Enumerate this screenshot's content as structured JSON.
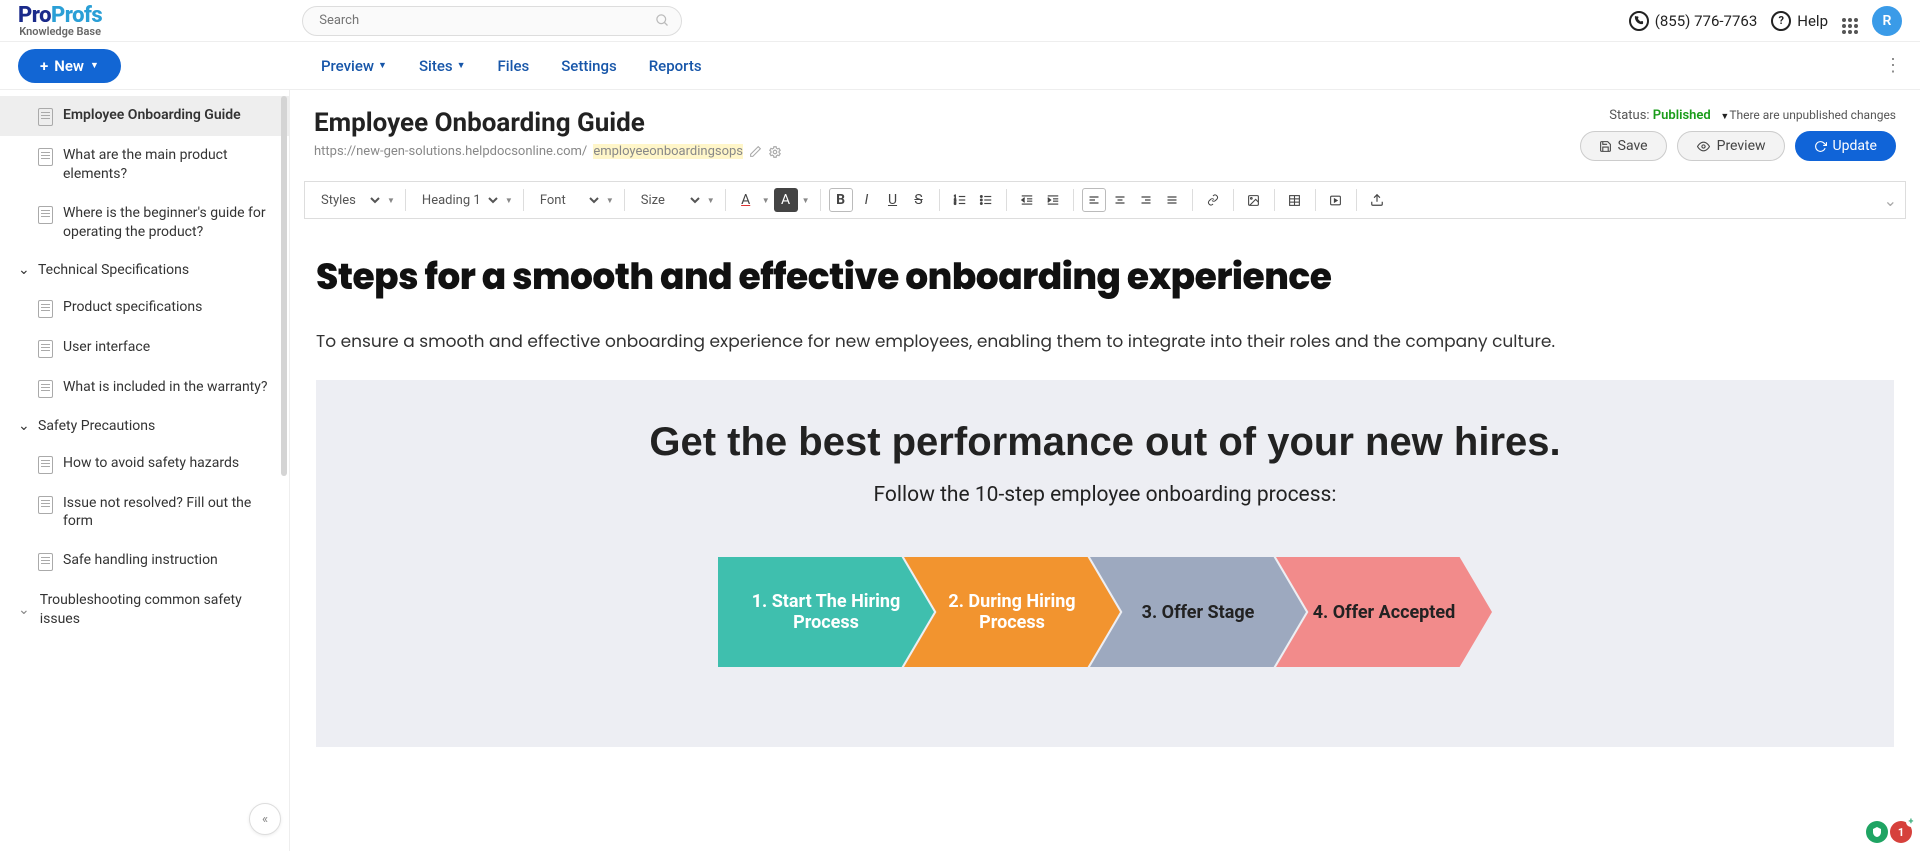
{
  "header": {
    "logo_pro": "Pro",
    "logo_profs": "Profs",
    "logo_sub": "Knowledge Base",
    "search_placeholder": "Search",
    "phone": "(855) 776-7763",
    "help": "Help",
    "avatar_initial": "R"
  },
  "nav": {
    "new_btn": "New",
    "links": [
      "Preview",
      "Sites",
      "Files",
      "Settings",
      "Reports"
    ]
  },
  "sidebar": {
    "items": [
      {
        "label": "Employee Onboarding Guide",
        "active": true
      },
      {
        "label": "What are the main product elements?"
      },
      {
        "label": "Where is the beginner's guide for operating the product?"
      }
    ],
    "sections": [
      {
        "title": "Technical Specifications",
        "items": [
          "Product specifications",
          "User interface",
          "What is included in the warranty?"
        ]
      },
      {
        "title": "Safety Precautions",
        "items": [
          "How to avoid safety hazards",
          "Issue not resolved? Fill out the form",
          "Safe handling instruction",
          "Troubleshooting common safety issues"
        ]
      }
    ]
  },
  "doc": {
    "title": "Employee Onboarding Guide",
    "url_base": "https://new-gen-solutions.helpdocsonline.com/",
    "url_slug": "employeeonboardingsops",
    "status_label": "Status:",
    "status_value": "Published",
    "unpublished_note": "There are unpublished changes",
    "save": "Save",
    "preview": "Preview",
    "update": "Update"
  },
  "toolbar": {
    "styles": "Styles",
    "format": "Heading 1",
    "font": "Font",
    "size": "Size"
  },
  "editor": {
    "h1": "Steps for a smooth and effective onboarding experience",
    "lead": "To ensure a smooth and effective onboarding experience for new employees, enabling them to integrate into their roles and the company culture.",
    "info_title": "Get the best performance out of your new hires.",
    "info_sub": "Follow the 10-step employee onboarding process:",
    "steps": [
      "1. Start The Hiring Process",
      "2. During Hiring Process",
      "3. Offer Stage",
      "4. Offer Accepted"
    ]
  },
  "badges": {
    "red_count": "1"
  }
}
